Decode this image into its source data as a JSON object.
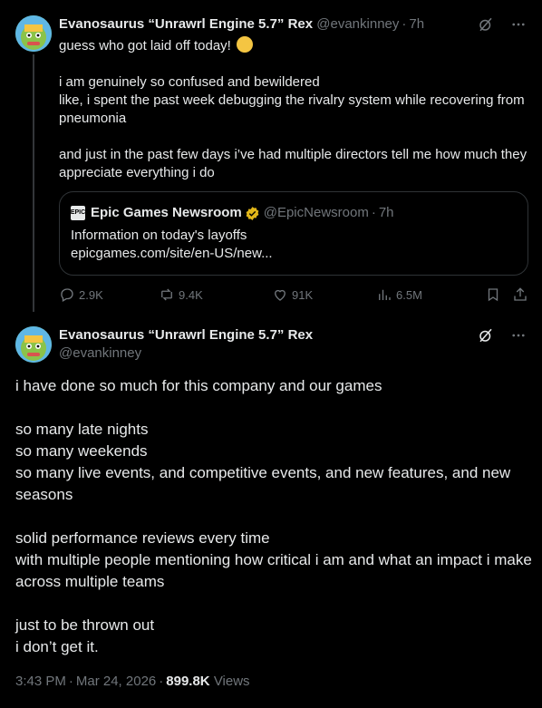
{
  "tweet1": {
    "author_name": "Evanosaurus “Unrawrl Engine 5.7” Rex",
    "handle": "@evankinney",
    "time": "7h",
    "body": "guess who got laid off today!",
    "body_emoji": "face-with-hand-over-mouth",
    "body_rest": "\ni am genuinely so confused and bewildered\nlike, i spent the past week debugging the rivalry system while recovering from pneumonia\n\nand just in the past few days i’ve had multiple directors tell me how much they appreciate everything i do",
    "quote": {
      "logo_text": "EPIC",
      "name": "Epic Games Newsroom",
      "handle": "@EpicNewsroom",
      "time": "7h",
      "text": "Information on today's layoffs\nepicgames.com/site/en-US/new..."
    },
    "stats": {
      "replies": "2.9K",
      "reposts": "9.4K",
      "likes": "91K",
      "views": "6.5M"
    }
  },
  "tweet2": {
    "author_name": "Evanosaurus “Unrawrl Engine 5.7” Rex",
    "handle": "@evankinney",
    "body": "i have done so much for this company and our games\n\nso many late nights\nso many weekends\nso many live events, and competitive events, and new features, and new seasons\n\nsolid performance reviews every time\nwith multiple people mentioning how critical i am and what an impact i make across multiple teams\n\njust to be thrown out\ni don’t get it.",
    "time": "3:43 PM",
    "date": "Mar 24, 2026",
    "views_count": "899.8K",
    "views_label": "Views"
  },
  "colors": {
    "background": "#000000",
    "text": "#e7e9ea",
    "muted": "#71767b",
    "border": "#2f3336",
    "verified_gold": "#e2b719"
  }
}
